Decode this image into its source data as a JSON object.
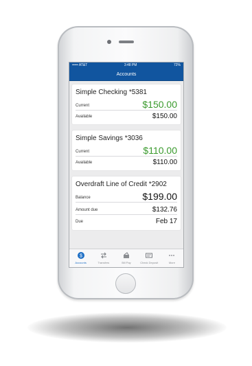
{
  "status": {
    "carrier": "••••• AT&T",
    "time": "3:48 PM",
    "battery": "72%"
  },
  "header": {
    "title": "Accounts"
  },
  "accounts": [
    {
      "title": "Simple Checking *5381",
      "rows": [
        {
          "label": "Current",
          "value": "$150.00"
        },
        {
          "label": "Available",
          "value": "$150.00"
        }
      ]
    },
    {
      "title": "Simple Savings *3036",
      "rows": [
        {
          "label": "Current",
          "value": "$110.00"
        },
        {
          "label": "Available",
          "value": "$110.00"
        }
      ]
    },
    {
      "title": "Overdraft Line of Credit *2902",
      "rows": [
        {
          "label": "Balance",
          "value": "$199.00"
        },
        {
          "label": "Amount due",
          "value": "$132.76"
        },
        {
          "label": "Due",
          "value": "Feb 17"
        }
      ]
    }
  ],
  "tabs": [
    {
      "label": "Accounts",
      "icon": "dollar-icon",
      "active": true
    },
    {
      "label": "Transfers",
      "icon": "transfer-arrows-icon",
      "active": false
    },
    {
      "label": "Bill Pay",
      "icon": "bill-pay-icon",
      "active": false
    },
    {
      "label": "Check Deposit",
      "icon": "check-deposit-icon",
      "active": false
    },
    {
      "label": "More",
      "icon": "more-dots-icon",
      "active": false
    }
  ],
  "colors": {
    "brand": "#11559f",
    "positive": "#3a9a2d",
    "active_tab": "#1e6fc5"
  }
}
